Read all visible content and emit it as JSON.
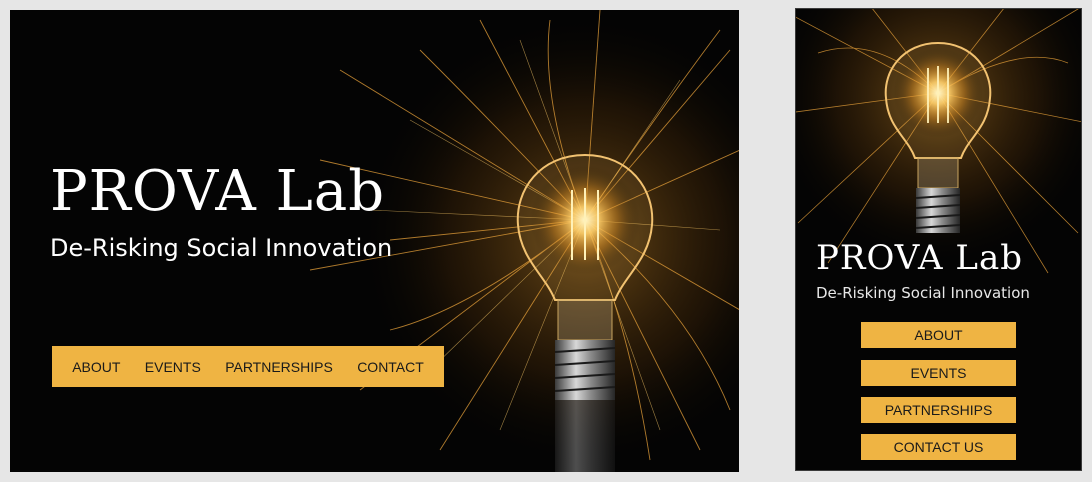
{
  "site": {
    "logo_text": "PROVA Lab",
    "tagline": "De-Risking Social Innovation"
  },
  "desktop_nav": {
    "items": [
      "ABOUT",
      "EVENTS",
      "PARTNERSHIPS",
      "CONTACT"
    ]
  },
  "mobile_nav": {
    "items": [
      "ABOUT",
      "EVENTS",
      "PARTNERSHIPS",
      "CONTACT US"
    ]
  },
  "colors": {
    "nav_background": "#efb443",
    "nav_text": "#1a1a1a",
    "hero_background": "#040404",
    "page_background": "#e6e6e6"
  }
}
